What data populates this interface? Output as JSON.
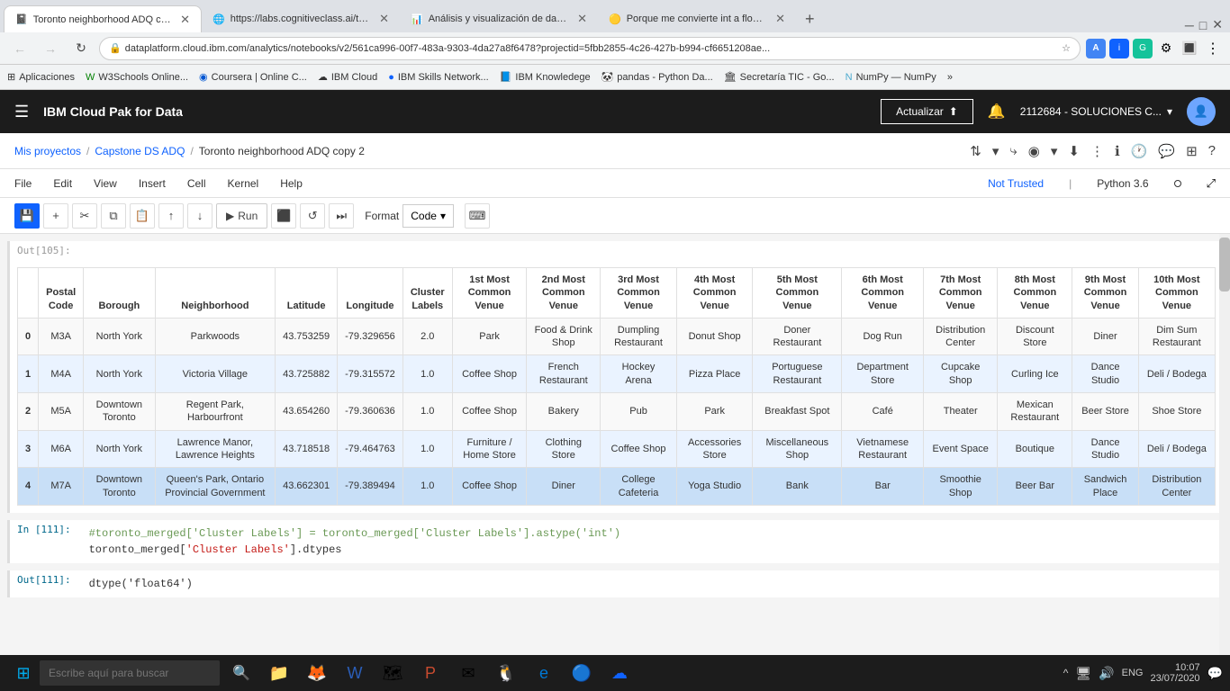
{
  "browser": {
    "tabs": [
      {
        "id": "tab1",
        "title": "Toronto neighborhood ADQ cop...",
        "favicon": "📓",
        "active": true
      },
      {
        "id": "tab2",
        "title": "https://labs.cognitiveclass.ai/too...",
        "favicon": "🌐",
        "active": false
      },
      {
        "id": "tab3",
        "title": "Análisis y visualización de datos...",
        "favicon": "📊",
        "active": false
      },
      {
        "id": "tab4",
        "title": "Porque me convierte int a float, e...",
        "favicon": "🟡",
        "active": false
      }
    ],
    "url": "dataplatform.cloud.ibm.com/analytics/notebooks/v2/561ca996-00f7-483a-9303-4da27a8f6478?projectid=5fbb2855-4c26-427b-b994-cf6651208ae...",
    "bookmarks": [
      {
        "label": "Aplicaciones",
        "icon": "⊞"
      },
      {
        "label": "W3Schools Online...",
        "icon": "🟢"
      },
      {
        "label": "Coursera | Online C...",
        "icon": "🔵"
      },
      {
        "label": "IBM Cloud",
        "icon": "☁"
      },
      {
        "label": "IBM Skills Network...",
        "icon": "🔵"
      },
      {
        "label": "IBM Knowledege",
        "icon": "📘"
      },
      {
        "label": "pandas - Python Da...",
        "icon": "📊"
      },
      {
        "label": "Secretaría TIC - Go...",
        "icon": "🏛"
      },
      {
        "label": "NumPy — NumPy",
        "icon": "🔵"
      }
    ]
  },
  "ibm_header": {
    "app_name": "IBM Cloud Pak for Data",
    "update_btn": "Actualizar",
    "user_label": "2112684 - SOLUCIONES C...",
    "upload_icon": "⬆"
  },
  "breadcrumb": {
    "projects": "Mis proyectos",
    "project": "Capstone DS ADQ",
    "notebook": "Toronto neighborhood ADQ copy 2"
  },
  "menu": {
    "items": [
      "File",
      "Edit",
      "View",
      "Insert",
      "Cell",
      "Kernel",
      "Help"
    ],
    "trusted": "Not Trusted",
    "kernel": "Python 3.6"
  },
  "toolbar": {
    "run_label": "Run",
    "format_label": "Format",
    "code_label": "Code"
  },
  "output_label": "Out[105]:",
  "table": {
    "headers": [
      "",
      "Postal Code",
      "Borough",
      "Neighborhood",
      "Latitude",
      "Longitude",
      "Cluster Labels",
      "1st Most Common Venue",
      "2nd Most Common Venue",
      "3rd Most Common Venue",
      "4th Most Common Venue",
      "5th Most Common Venue",
      "6th Most Common Venue",
      "7th Most Common Venue",
      "8th Most Common Venue",
      "9th Most Common Venue",
      "10th Most Common Venue"
    ],
    "rows": [
      {
        "idx": "0",
        "postal": "M3A",
        "borough": "North York",
        "neighborhood": "Parkwoods",
        "lat": "43.753259",
        "lon": "-79.329656",
        "cluster": "2.0",
        "v1": "Park",
        "v2": "Food & Drink Shop",
        "v3": "Dumpling Restaurant",
        "v4": "Donut Shop",
        "v5": "Doner Restaurant",
        "v6": "Dog Run",
        "v7": "Distribution Center",
        "v8": "Discount Store",
        "v9": "Diner",
        "v10": "Dim Sum Restaurant"
      },
      {
        "idx": "1",
        "postal": "M4A",
        "borough": "North York",
        "neighborhood": "Victoria Village",
        "lat": "43.725882",
        "lon": "-79.315572",
        "cluster": "1.0",
        "v1": "Coffee Shop",
        "v2": "French Restaurant",
        "v3": "Hockey Arena",
        "v4": "Pizza Place",
        "v5": "Portuguese Restaurant",
        "v6": "Department Store",
        "v7": "Cupcake Shop",
        "v8": "Curling Ice",
        "v9": "Dance Studio",
        "v10": "Deli / Bodega"
      },
      {
        "idx": "2",
        "postal": "M5A",
        "borough": "Downtown Toronto",
        "neighborhood": "Regent Park, Harbourfront",
        "lat": "43.654260",
        "lon": "-79.360636",
        "cluster": "1.0",
        "v1": "Coffee Shop",
        "v2": "Bakery",
        "v3": "Pub",
        "v4": "Park",
        "v5": "Breakfast Spot",
        "v6": "Café",
        "v7": "Theater",
        "v8": "Mexican Restaurant",
        "v9": "Beer Store",
        "v10": "Shoe Store"
      },
      {
        "idx": "3",
        "postal": "M6A",
        "borough": "North York",
        "neighborhood": "Lawrence Manor, Lawrence Heights",
        "lat": "43.718518",
        "lon": "-79.464763",
        "cluster": "1.0",
        "v1": "Furniture / Home Store",
        "v2": "Clothing Store",
        "v3": "Coffee Shop",
        "v4": "Accessories Store",
        "v5": "Miscellaneous Shop",
        "v6": "Vietnamese Restaurant",
        "v7": "Event Space",
        "v8": "Boutique",
        "v9": "Dance Studio",
        "v10": "Deli / Bodega"
      },
      {
        "idx": "4",
        "postal": "M7A",
        "borough": "Downtown Toronto",
        "neighborhood": "Queen's Park, Ontario Provincial Government",
        "lat": "43.662301",
        "lon": "-79.389494",
        "cluster": "1.0",
        "v1": "Coffee Shop",
        "v2": "Diner",
        "v3": "College Cafeteria",
        "v4": "Yoga Studio",
        "v5": "Bank",
        "v6": "Bar",
        "v7": "Smoothie Shop",
        "v8": "Beer Bar",
        "v9": "Sandwich Place",
        "v10": "Distribution Center"
      }
    ]
  },
  "code_cell": {
    "label": "In [111]:",
    "comment": "#toronto_merged['Cluster Labels'] = toronto_merged['Cluster Labels'].astype('int')",
    "code": "toronto_merged['Cluster Labels'].dtypes",
    "output_label": "Out[111]:",
    "output": "dtype('float64')"
  },
  "taskbar": {
    "search_placeholder": "Escribe aquí para buscar",
    "time": "10:07",
    "date": "23/07/2020",
    "lang": "ENG"
  }
}
